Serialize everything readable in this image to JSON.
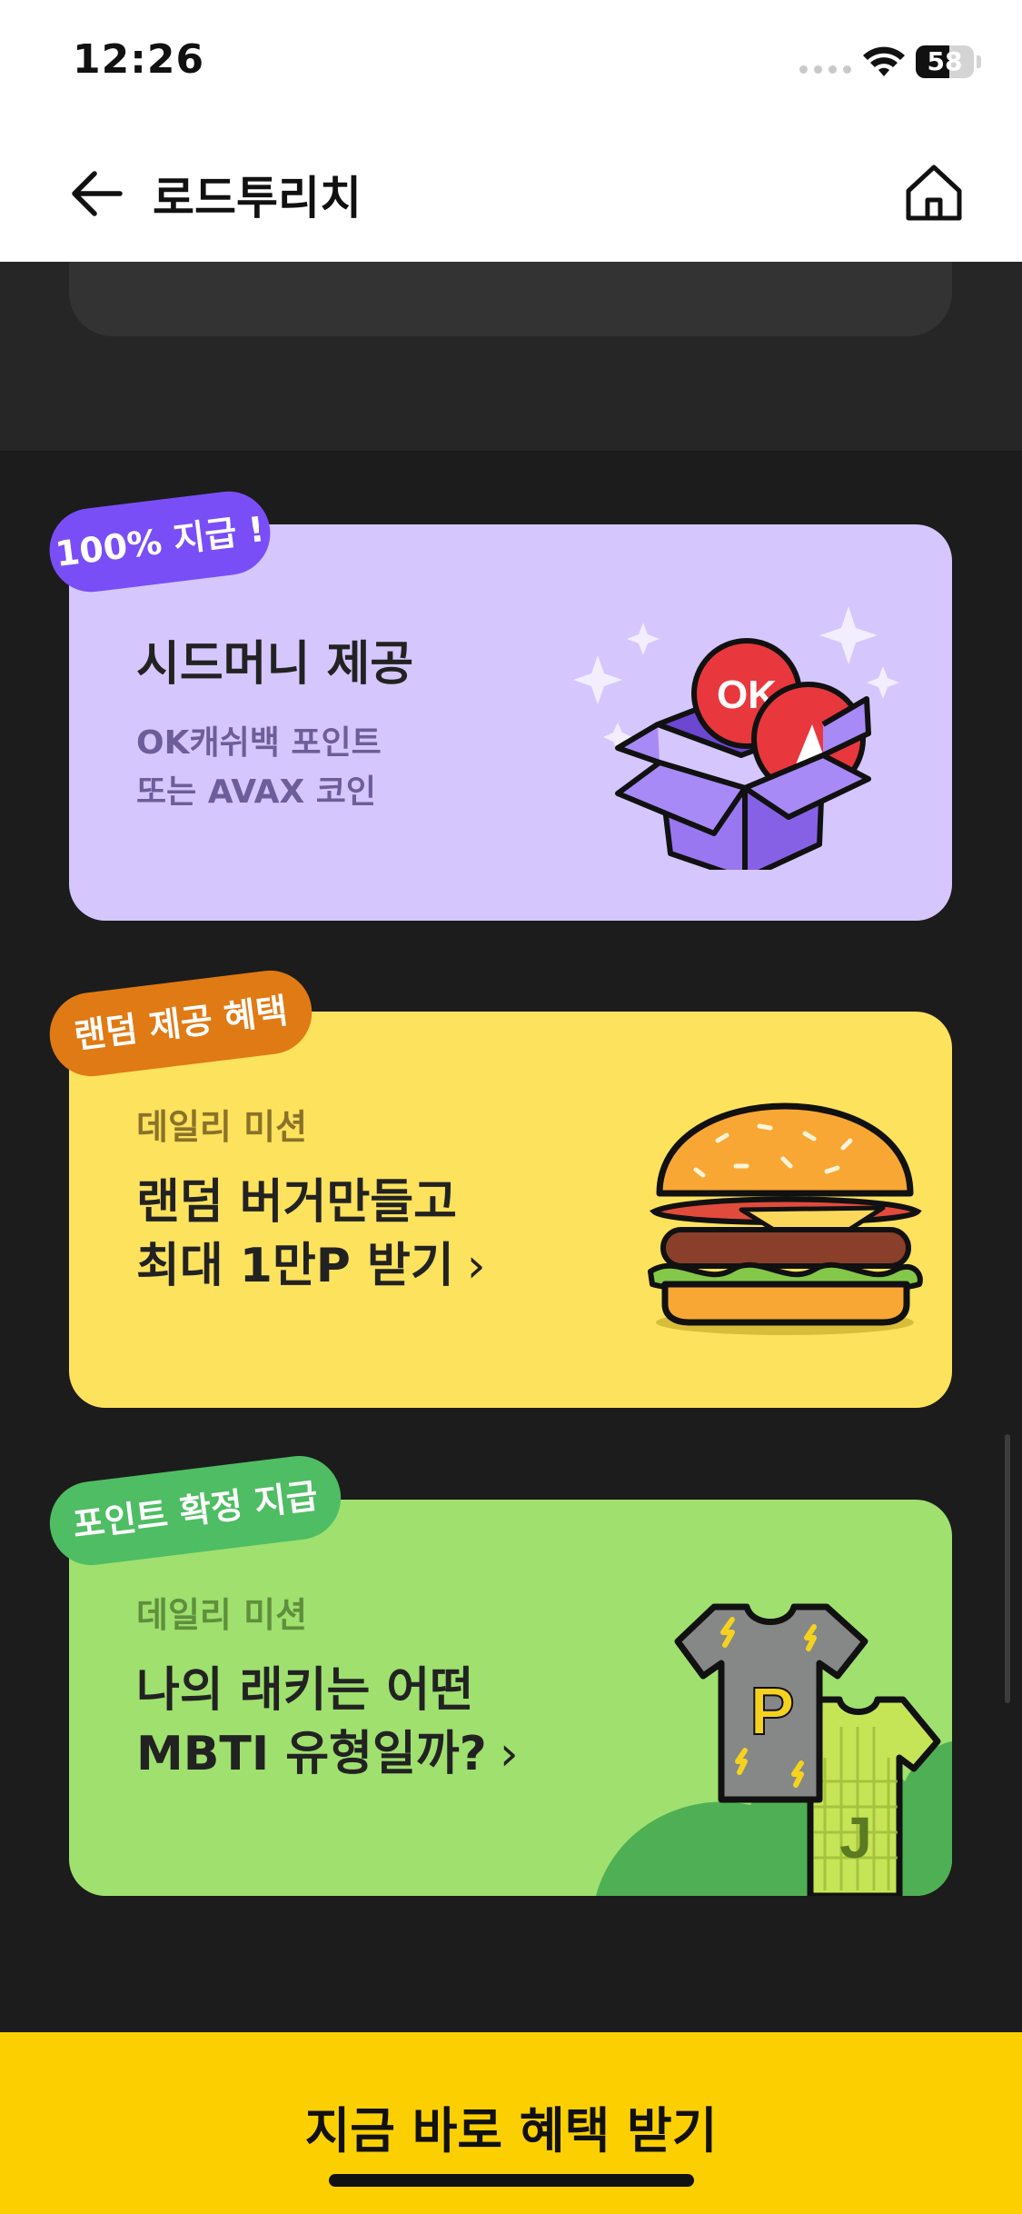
{
  "status_bar": {
    "time": "12:26",
    "battery_level": "58"
  },
  "nav": {
    "title": "로드투리치",
    "back_icon": "back-arrow-icon",
    "home_icon": "home-icon"
  },
  "cards": [
    {
      "badge": "100% 지급 !",
      "title": "시드머니 제공",
      "subtitle_line1": "OK캐쉬백 포인트",
      "subtitle_line2": "또는 AVAX 코인",
      "illustration": "gift-box-coins-icon",
      "coin_label": "OK",
      "color": "#d5c7fd",
      "badge_color": "#7a4ef6"
    },
    {
      "badge": "랜덤 제공 혜택",
      "label": "데일리 미션",
      "title_line1": "랜덤 버거만들고",
      "title_line2": "최대 1만P 받기",
      "illustration": "burger-icon",
      "color": "#fde25d",
      "badge_color": "#e07a14"
    },
    {
      "badge": "포인트 확정 지급",
      "label": "데일리 미션",
      "title_line1": "나의 래키는 어떤",
      "title_line2": "MBTI 유형일까?",
      "illustration": "tshirts-icon",
      "shirt_letter_1": "P",
      "shirt_letter_2": "J",
      "color": "#9fe06f",
      "badge_color": "#4fbd63"
    }
  ],
  "cta": {
    "label": "지금 바로 혜택 받기",
    "color": "#fcd000"
  }
}
